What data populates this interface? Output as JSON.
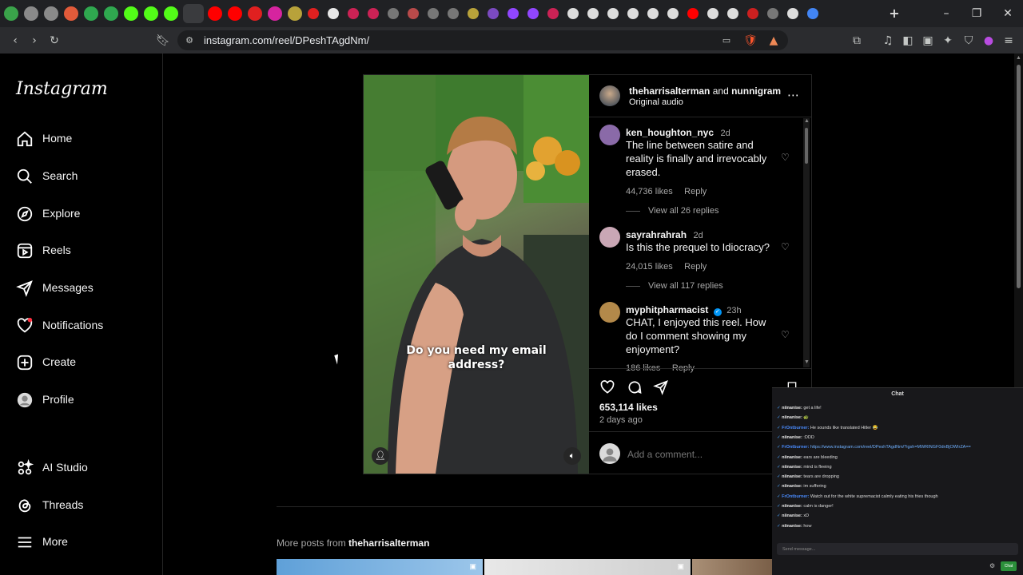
{
  "browser": {
    "url": "instagram.com/reel/DPeshTAgdNm/",
    "tabs": [
      {
        "icon": "tab-icon",
        "color": "#3aa34a"
      },
      {
        "icon": "tab-icon",
        "color": "#8a8a8a"
      },
      {
        "icon": "tab-icon",
        "color": "#8a8a8a"
      },
      {
        "icon": "tab-icon",
        "color": "#e25b3a"
      },
      {
        "icon": "tab-icon",
        "color": "#2fa84f"
      },
      {
        "icon": "tab-icon",
        "color": "#2fa84f"
      },
      {
        "icon": "kick-icon",
        "color": "#53fc18"
      },
      {
        "icon": "kick-icon",
        "color": "#53fc18"
      },
      {
        "icon": "kick-icon",
        "color": "#53fc18"
      },
      {
        "icon": "close-icon",
        "color": "#ddd"
      },
      {
        "icon": "youtube-icon",
        "color": "#ff0000"
      },
      {
        "icon": "youtube-icon",
        "color": "#ff0000"
      },
      {
        "icon": "tab-icon",
        "color": "#e02020"
      },
      {
        "icon": "instagram-icon",
        "color": "#d6249f"
      },
      {
        "icon": "tab-icon",
        "color": "#b8a23a"
      }
    ],
    "new_tab_glyph": "+"
  },
  "sidebar": {
    "logo": "Instagram",
    "items": [
      {
        "label": "Home",
        "icon": "home-icon"
      },
      {
        "label": "Search",
        "icon": "search-icon"
      },
      {
        "label": "Explore",
        "icon": "explore-icon"
      },
      {
        "label": "Reels",
        "icon": "reels-icon"
      },
      {
        "label": "Messages",
        "icon": "messages-icon"
      },
      {
        "label": "Notifications",
        "icon": "heart-icon"
      },
      {
        "label": "Create",
        "icon": "create-icon"
      },
      {
        "label": "Profile",
        "icon": "avatar"
      },
      {
        "label": "AI Studio",
        "icon": "ai-studio-icon"
      },
      {
        "label": "Threads",
        "icon": "threads-icon"
      },
      {
        "label": "More",
        "icon": "menu-icon"
      }
    ]
  },
  "reel": {
    "caption": "Do you need my email address?",
    "author": "theharrisalterman",
    "connector": "and",
    "coauthor": "nunnigram",
    "audio": "Original audio",
    "likes": "653,114 likes",
    "posted": "2 days ago",
    "add_comment_placeholder": "Add a comment...",
    "comments": [
      {
        "user": "ken_houghton_nyc",
        "time": "2d",
        "text": "The line between satire and reality is finally and irrevocably erased.",
        "likes": "44,736 likes",
        "reply": "Reply",
        "view_replies": "View all 26 replies"
      },
      {
        "user": "sayrahrahrah",
        "time": "2d",
        "text": "Is this the prequel to Idiocracy?",
        "likes": "24,015 likes",
        "reply": "Reply",
        "view_replies": "View all 117 replies"
      },
      {
        "user": "myphitpharmacist",
        "time": "23h",
        "text": "CHAT, I enjoyed this reel. How do I comment showing my enjoyment?",
        "likes": "186 likes",
        "reply": "Reply"
      }
    ]
  },
  "more_posts": {
    "prefix": "More posts from",
    "user": "theharrisalterman"
  },
  "chat": {
    "title": "Chat",
    "lines": [
      {
        "user": "niinanise:",
        "text": "get a life!"
      },
      {
        "user": "niinanise:",
        "text": "🐢"
      },
      {
        "user": "FrOntburner:",
        "text": "He sounds like translated Hitler 😂"
      },
      {
        "user": "niinanise:",
        "text": ":DDD"
      },
      {
        "user": "FrOntburner:",
        "text": "https://www.instagram.com/reel/DPeshTAgdNm/?igsh=MWRINGF0dnBjOWIrZA=="
      },
      {
        "user": "niinanise:",
        "text": "ears are bleeding"
      },
      {
        "user": "niinanise:",
        "text": "mind is fleeing"
      },
      {
        "user": "niinanise:",
        "text": "tears are dropping"
      },
      {
        "user": "niinanise:",
        "text": "im suffering"
      },
      {
        "user": "FrOntburner:",
        "text": "Watch out for the white supremacist calmly eating his fries though"
      },
      {
        "user": "niinanise:",
        "text": "calm is danger!"
      },
      {
        "user": "niinanise:",
        "text": "xD"
      },
      {
        "user": "niinanise:",
        "text": "how"
      }
    ],
    "input_placeholder": "Send message...",
    "send_label": "Chat"
  }
}
